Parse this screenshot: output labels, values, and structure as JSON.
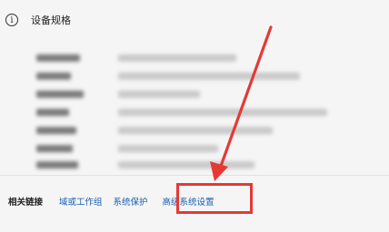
{
  "header": {
    "info_icon": "info-icon",
    "title": "设备规格"
  },
  "related_links": {
    "label": "相关链接",
    "items": [
      {
        "label": "域或工作组"
      },
      {
        "label": "系统保护"
      },
      {
        "label": "高级系统设置"
      }
    ]
  },
  "annotation": {
    "color": "#e53935",
    "arrow_icon": "arrow-icon",
    "highlight_target": "高级系统设置"
  },
  "colors": {
    "link": "#1a5fb4",
    "background": "#f5f5f5"
  }
}
